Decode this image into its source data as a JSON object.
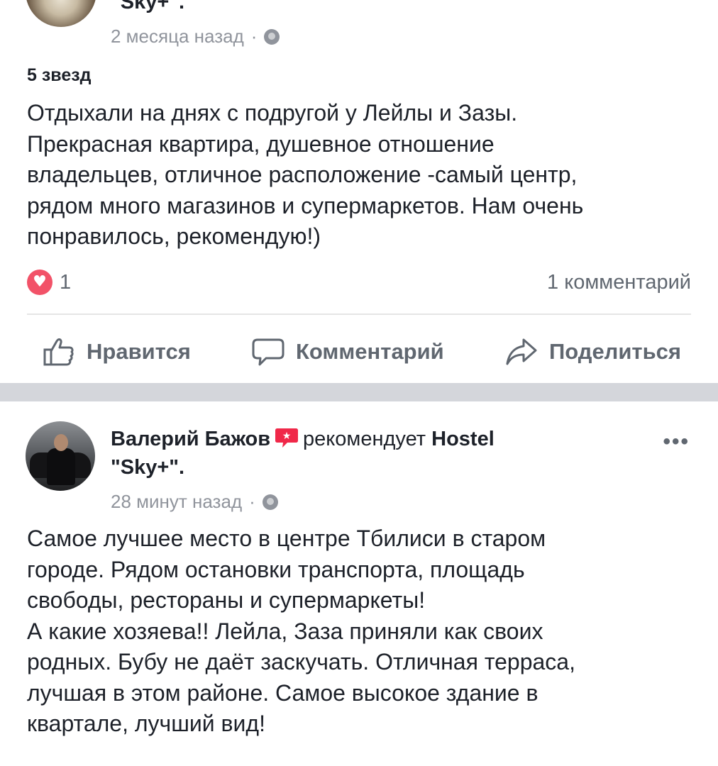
{
  "post1": {
    "name_tail": "\"Sky+\".",
    "time": "2 месяца назад",
    "separator": "·",
    "rating": "5 звезд",
    "body": "Отдыхали на днях с подругой у Лейлы и Зазы.\nПрекрасная  квартира, душевное отношение\nвладельцев,  отличное расположение -самый центр,\nрядом много магазинов и супермаркетов. Нам очень\nпонравилось,  рекомендую!)",
    "reactions_count": "1",
    "comments_count": "1 комментарий",
    "actions": {
      "like": "Нравится",
      "comment": "Комментарий",
      "share": "Поделиться"
    }
  },
  "post2": {
    "author": "Валерий Бажов",
    "recommends": "рекомендует",
    "page_name_line1": "Hostel",
    "page_name_line2": "\"Sky+\".",
    "time": "28 минут назад",
    "separator": "·",
    "more": "•••",
    "body": "Самое лучшее место в центре Тбилиси в старом\nгороде. Рядом остановки транспорта, площадь\nсвободы, рестораны и супермаркеты!\nА какие хозяева!! Лейла, Заза приняли как своих\nродных. Бубу не даёт заскучать. Отличная терраса,\nлучшая в этом районе. Самое высокое здание в\nквартале, лучший вид!"
  },
  "colors": {
    "text": "#1d2129",
    "secondary": "#90949c",
    "action": "#606770",
    "love": "#f25268",
    "divider": "#d4d6db"
  },
  "icons": {
    "privacy": "globe-icon",
    "reaction": "love-reaction-icon",
    "like": "thumbs-up-icon",
    "comment": "speech-bubble-icon",
    "share": "share-arrow-icon",
    "recommend": "recommend-badge-icon"
  }
}
